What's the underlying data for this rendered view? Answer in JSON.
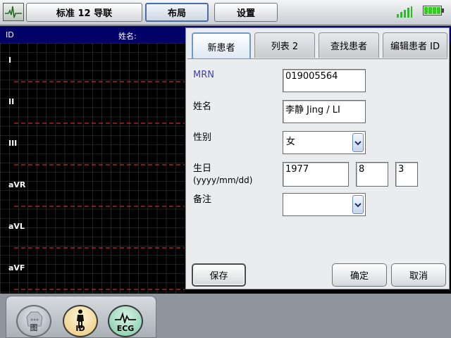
{
  "toolbar": {
    "logo_icon": "ecg-monitor-icon",
    "buttons": [
      {
        "label": "标准 12 导联",
        "active": false
      },
      {
        "label": "布局",
        "active": true
      },
      {
        "label": "设置",
        "active": false
      }
    ],
    "signal_icon": "signal-strength-icon",
    "battery_icon": "battery-icon"
  },
  "ecg": {
    "header_id_label": "ID",
    "header_name_label": "姓名:",
    "leads": [
      "I",
      "II",
      "III",
      "aVR",
      "aVL",
      "aVF"
    ],
    "grid_color": "#555555",
    "trace_color": "#ff3333"
  },
  "dialog": {
    "tabs": [
      "新患者",
      "列表 2",
      "查找患者",
      "编辑患者 ID"
    ],
    "active_tab": 0,
    "fields": {
      "mrn_label": "MRN",
      "mrn_value": "019005564",
      "name_label": "姓名",
      "name_value": "李静 Jing / LI",
      "sex_label": "性别",
      "sex_value": "女",
      "dob_label_line1": "生日",
      "dob_label_line2": "(yyyy/mm/dd)",
      "dob_year": "1977",
      "dob_month": "8",
      "dob_day": "3",
      "notes_label": "备注",
      "notes_value": ""
    },
    "buttons": {
      "save": "保存",
      "ok": "确定",
      "cancel": "取消"
    }
  },
  "bottom": {
    "buttons": [
      {
        "label": "图",
        "icon": "body-chest-icon"
      },
      {
        "label": "ID",
        "icon": "person-icon"
      },
      {
        "label": "ECG",
        "icon": "ecg-wave-icon"
      }
    ]
  },
  "colors": {
    "accent": "#4b6ea8",
    "header_bg": "#000066",
    "battery": "#33cc22",
    "signal": "#2eb82e"
  }
}
